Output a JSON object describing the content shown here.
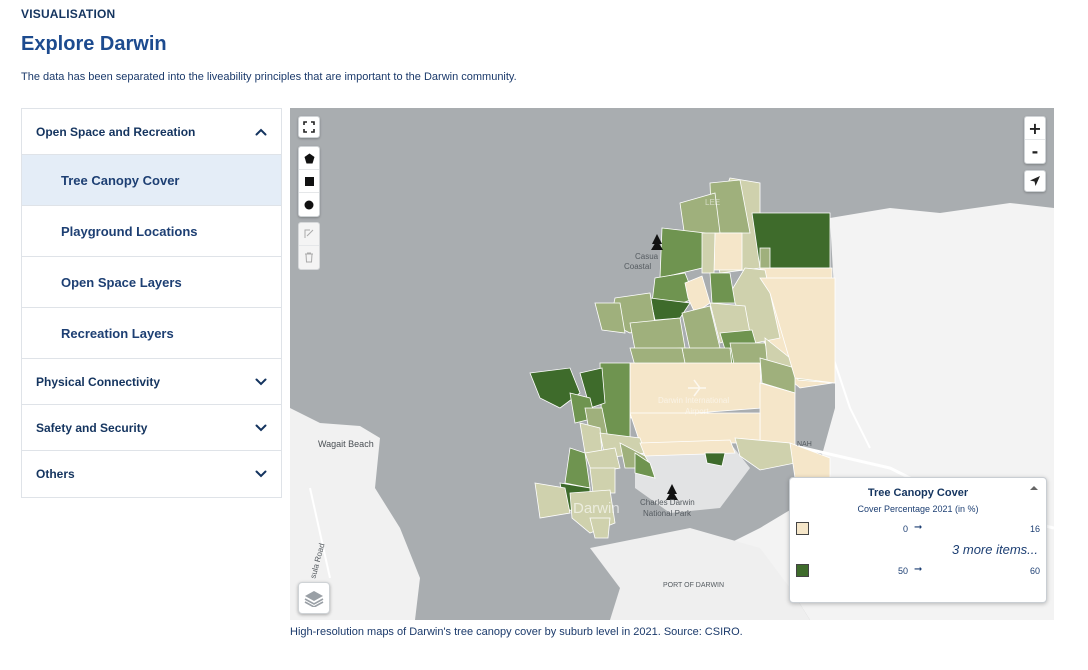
{
  "header": {
    "eyebrow": "VISUALISATION",
    "title": "Explore Darwin",
    "intro": "The data has been separated into the liveability principles that are important to the Darwin community."
  },
  "accordion": {
    "sections": [
      {
        "label": "Open Space and Recreation",
        "expanded": true
      },
      {
        "label": "Physical Connectivity",
        "expanded": false
      },
      {
        "label": "Safety and Security",
        "expanded": false
      },
      {
        "label": "Others",
        "expanded": false
      }
    ],
    "items": [
      {
        "label": "Tree Canopy Cover",
        "active": true
      },
      {
        "label": "Playground Locations",
        "active": false
      },
      {
        "label": "Open Space Layers",
        "active": false
      },
      {
        "label": "Recreation Layers",
        "active": false
      }
    ]
  },
  "map": {
    "controls": {
      "fullscreen_icon": "fullscreen-icon",
      "draw_tools": [
        "polygon-icon",
        "rectangle-icon",
        "circle-icon"
      ],
      "edit_tools": [
        "edit-icon",
        "trash-icon"
      ],
      "zoom_in": "+",
      "zoom_out": "-",
      "locate_icon": "locate-arrow-icon",
      "layers_icon": "layers-icon"
    },
    "labels": {
      "wagait": "Wagait Beach",
      "casuarina_1": "Casua",
      "casuarina_2": "Coastal",
      "charles_1": "Charles Darwin",
      "charles_2": "National Park",
      "port": "PORT OF DARWIN",
      "road": "sula Road",
      "airport_1": "Darwin International",
      "airport_2": "Airport",
      "darwin": "Darwin",
      "lee": "LEE",
      "nah": "NAH"
    },
    "colors": {
      "water": "#a9adb0",
      "land": "#f3f3f3",
      "lightest": "#f5e6c9",
      "light": "#cfd1ad",
      "mid": "#9fb07c",
      "dark": "#6f9450",
      "darkest": "#3e6b2b"
    }
  },
  "legend": {
    "title": "Tree Canopy Cover",
    "subtitle": "Cover Percentage 2021 (in %)",
    "rows": [
      {
        "from": "0",
        "to": "16",
        "color": "#f5e6c9"
      },
      {
        "from": "50",
        "to": "60",
        "color": "#3e6b2b"
      }
    ],
    "arrow": "➞",
    "more": "3 more items..."
  },
  "caption": "High-resolution maps of Darwin's tree canopy cover by suburb level in 2021. Source: CSIRO."
}
